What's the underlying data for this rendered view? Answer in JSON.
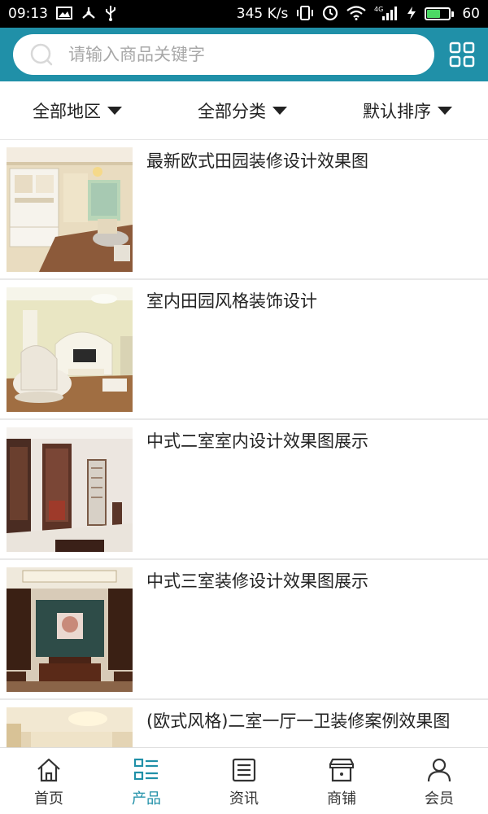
{
  "status_bar": {
    "time": "09:13",
    "net_speed": "345 K/s",
    "battery": "60",
    "icons": [
      "gallery-icon",
      "usb-tether-icon",
      "usb-icon",
      "vibrate-icon",
      "alarm-icon",
      "wifi-icon",
      "signal-4g-icon",
      "charging-icon",
      "battery-icon"
    ]
  },
  "search": {
    "placeholder": "请输入商品关键字",
    "value": ""
  },
  "filters": [
    {
      "label": "全部地区"
    },
    {
      "label": "全部分类"
    },
    {
      "label": "默认排序"
    }
  ],
  "products": [
    {
      "title": "最新欧式田园装修设计效果图"
    },
    {
      "title": "室内田园风格装饰设计"
    },
    {
      "title": "中式二室室内设计效果图展示"
    },
    {
      "title": "中式三室装修设计效果图展示"
    },
    {
      "title": "(欧式风格)二室一厅一卫装修案例效果图"
    }
  ],
  "bottom_nav": [
    {
      "label": "首页",
      "icon": "home-icon"
    },
    {
      "label": "产品",
      "icon": "product-list-icon",
      "active": true
    },
    {
      "label": "资讯",
      "icon": "news-icon"
    },
    {
      "label": "商铺",
      "icon": "shop-icon"
    },
    {
      "label": "会员",
      "icon": "user-icon"
    }
  ],
  "colors": {
    "accent": "#2090a8",
    "text": "#222222",
    "divider": "#e8e8e8"
  }
}
